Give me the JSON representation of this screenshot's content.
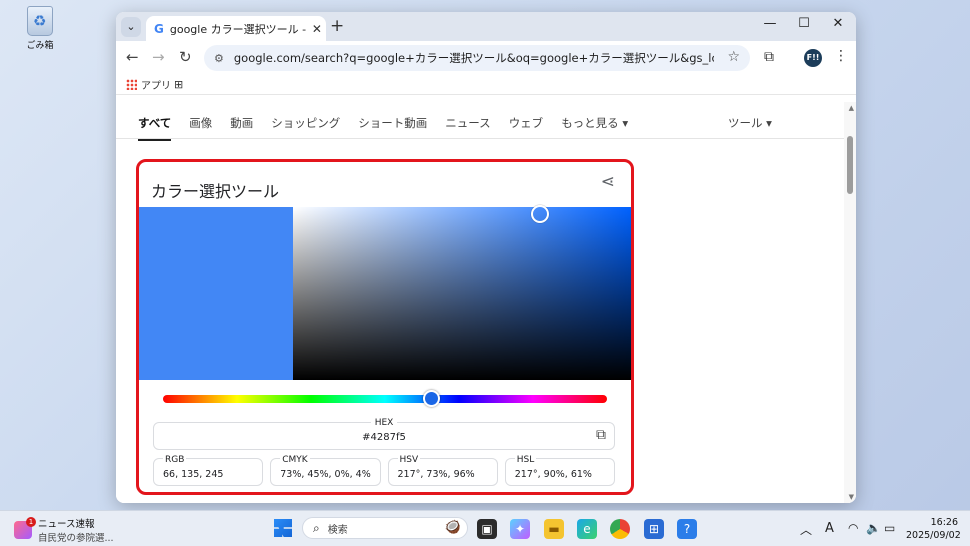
{
  "desktop": {
    "recycle_bin_label": "ごみ箱"
  },
  "browser": {
    "tab_title": "google カラー選択ツール - Google",
    "url": "google.com/search?q=google+カラー選択ツール&oq=google+カラー選択ツール&gs_lcrp=EgZjaHJvbWUy...",
    "profile_initials": "F!!",
    "bookmarks": {
      "apps_label": "アプリ"
    }
  },
  "search_tabs": [
    "すべて",
    "画像",
    "動画",
    "ショッピング",
    "ショート動画",
    "ニュース",
    "ウェブ",
    "もっと見る ▾"
  ],
  "tools_label": "ツール ▾",
  "color_picker": {
    "title": "カラー選択ツール",
    "hex_label": "HEX",
    "hex_value": "#4287f5",
    "swatch_color": "#4287f5",
    "hue_degrees": 217,
    "saturation_percent": 73,
    "value_percent": 96,
    "fields": [
      {
        "label": "RGB",
        "value": "66, 135, 245"
      },
      {
        "label": "CMYK",
        "value": "73%, 45%, 0%, 4%"
      },
      {
        "label": "HSV",
        "value": "217°, 73%, 96%"
      },
      {
        "label": "HSL",
        "value": "217°, 90%, 61%"
      }
    ]
  },
  "taskbar": {
    "news_title": "ニュース速報",
    "news_subtitle": "自民党の参院選...",
    "news_badge": "1",
    "search_placeholder": "検索",
    "ime_indicator": "A",
    "time": "16:26",
    "date": "2025/09/02"
  }
}
